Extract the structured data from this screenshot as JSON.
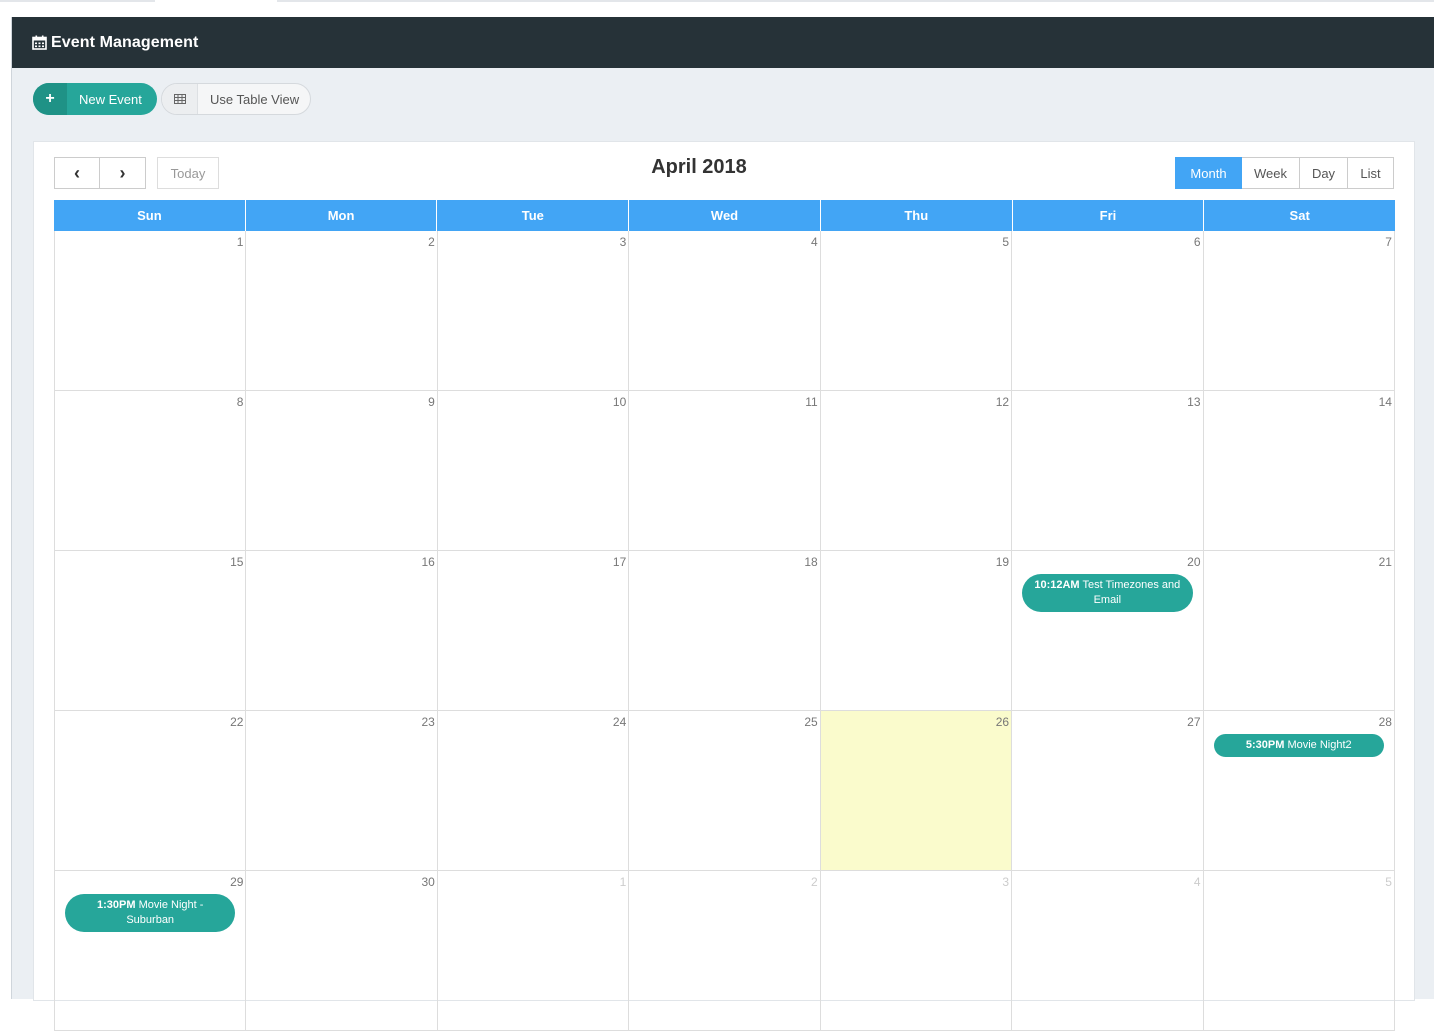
{
  "header": {
    "title": "Event Management",
    "icon": "calendar-icon"
  },
  "toolbar": {
    "new_event_label": "New Event",
    "table_view_label": "Use Table View"
  },
  "calendar": {
    "title": "April 2018",
    "today_label": "Today",
    "prev_symbol": "‹",
    "next_symbol": "›",
    "views": [
      "Month",
      "Week",
      "Day",
      "List"
    ],
    "active_view": "Month",
    "weekdays": [
      "Sun",
      "Mon",
      "Tue",
      "Wed",
      "Thu",
      "Fri",
      "Sat"
    ],
    "today_date": "26",
    "weeks": [
      [
        {
          "d": "1"
        },
        {
          "d": "2"
        },
        {
          "d": "3"
        },
        {
          "d": "4"
        },
        {
          "d": "5"
        },
        {
          "d": "6"
        },
        {
          "d": "7"
        }
      ],
      [
        {
          "d": "8"
        },
        {
          "d": "9"
        },
        {
          "d": "10"
        },
        {
          "d": "11"
        },
        {
          "d": "12"
        },
        {
          "d": "13"
        },
        {
          "d": "14"
        }
      ],
      [
        {
          "d": "15"
        },
        {
          "d": "16"
        },
        {
          "d": "17"
        },
        {
          "d": "18"
        },
        {
          "d": "19"
        },
        {
          "d": "20",
          "event": {
            "time": "10:12AM",
            "title": "Test Timezones and Email"
          }
        },
        {
          "d": "21"
        }
      ],
      [
        {
          "d": "22"
        },
        {
          "d": "23"
        },
        {
          "d": "24"
        },
        {
          "d": "25"
        },
        {
          "d": "26",
          "today": true
        },
        {
          "d": "27"
        },
        {
          "d": "28",
          "event": {
            "time": "5:30PM",
            "title": "Movie Night2"
          }
        }
      ],
      [
        {
          "d": "29",
          "event": {
            "time": "1:30PM",
            "title": "Movie Night - Suburban"
          }
        },
        {
          "d": "30"
        },
        {
          "d": "1",
          "other": true
        },
        {
          "d": "2",
          "other": true
        },
        {
          "d": "3",
          "other": true
        },
        {
          "d": "4",
          "other": true
        },
        {
          "d": "5",
          "other": true
        }
      ]
    ]
  },
  "colors": {
    "header_bg": "#263238",
    "accent": "#26a69a",
    "primary": "#42a5f5",
    "today_bg": "#fafbcc"
  }
}
